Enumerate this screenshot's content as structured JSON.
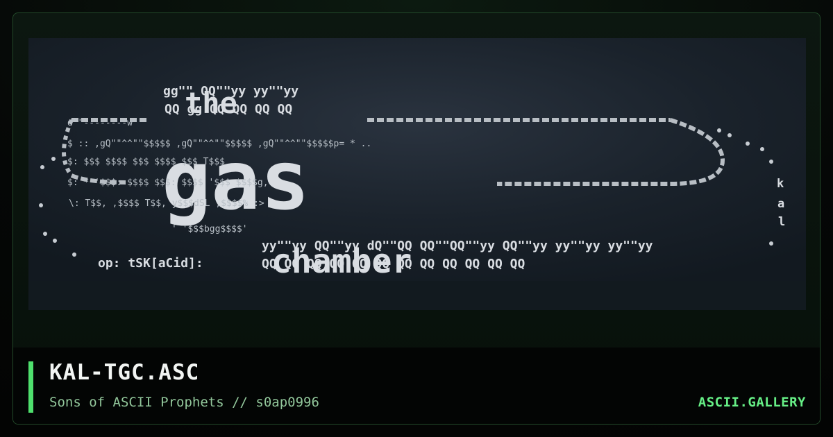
{
  "art": {
    "title_line_top": "gg\"\"  QQ\"\"yy yy\"\"yy",
    "title_line_mid": "QQ gg QQ QQ QQ QQ",
    "the_word": "the",
    "gas_word": "gas",
    "chamber_word": "chamber",
    "credit_line": "op: tSK[aCid]:",
    "side_letters": [
      "k",
      "a",
      "l"
    ],
    "ascii_rows": [
      "d\"\"--------w",
      "$  ::   ,gQ\"\"^^\"\"$$$$$  ,gQ\"\"^^\"\"$$$$$  ,gQ\"\"^^\"\"$$$$$p= *     ..",
      "$:      $$$     $$$$  $$$     $$$$  $$$     T$$$",
      "$:  *  '$$$:    $$$$  $$$:    $$$$  '$$$      $$$$g,",
      "\\:     T$$,     ,$$$$  T$$,     y$$$dSL    ,$$$$%    :>",
      "'      '$$$bgg$$$$'",
      "yy\"\"yy QQ\"\"yy dQ\"\"QQ QQ\"\"QQ\"\"yy QQ\"\"yy yy\"\"yy yy\"\"yy",
      "QQ    QQ QQ QQ QQ QQ QQ QQ QQ QQ QQ QQ"
    ]
  },
  "footer": {
    "title": "KAL-TGC.ASC",
    "subtitle": "Sons of ASCII Prophets // s0ap0996",
    "brand": "ASCII.GALLERY"
  },
  "colors": {
    "accent": "#4ee06d",
    "brand": "#66ef86",
    "subtitle": "#92c79b"
  }
}
